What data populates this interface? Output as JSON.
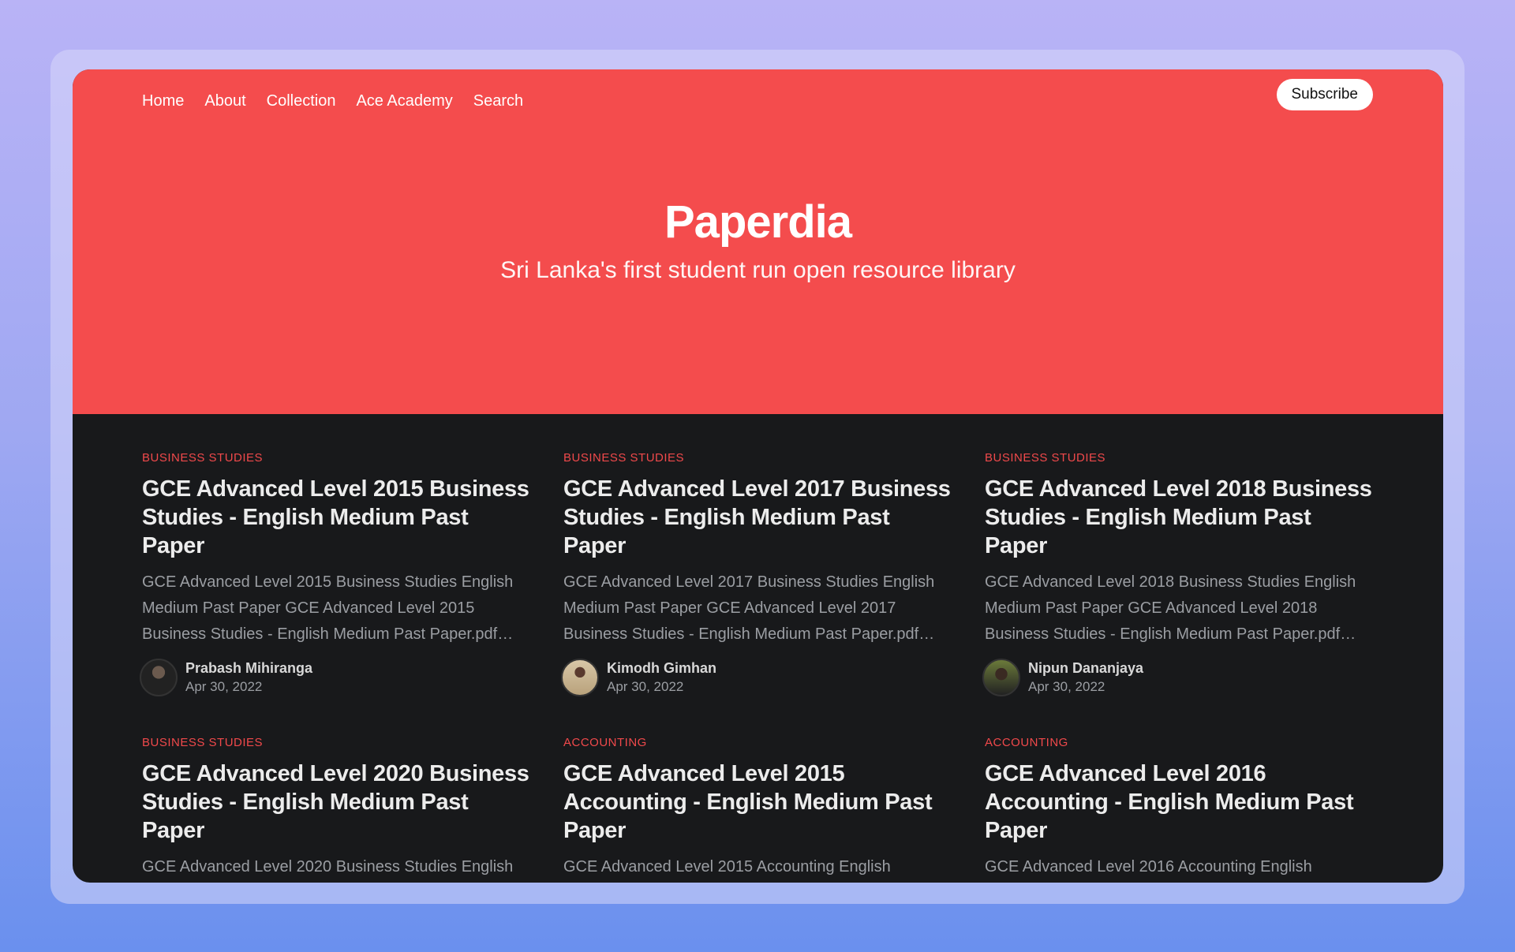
{
  "nav": {
    "items": [
      "Home",
      "About",
      "Collection",
      "Ace Academy",
      "Search"
    ],
    "subscribe": "Subscribe"
  },
  "hero": {
    "title": "Paperdia",
    "subtitle": "Sri Lanka's first student run open resource library"
  },
  "posts": [
    {
      "category": "BUSINESS STUDIES",
      "title": "GCE Advanced Level 2015 Business Studies - English Medium Past Paper",
      "excerpt": "GCE Advanced Level 2015 Business Studies English Medium Past Paper GCE Advanced Level 2015 Business Studies - English Medium Past Paper.pdf…",
      "author": "Prabash Mihiranga",
      "date": "Apr 30, 2022"
    },
    {
      "category": "BUSINESS STUDIES",
      "title": "GCE Advanced Level 2017 Business Studies - English Medium Past Paper",
      "excerpt": "GCE Advanced Level 2017 Business Studies English Medium Past Paper GCE Advanced Level 2017 Business Studies - English Medium Past Paper.pdf…",
      "author": "Kimodh Gimhan",
      "date": "Apr 30, 2022"
    },
    {
      "category": "BUSINESS STUDIES",
      "title": "GCE Advanced Level 2018 Business Studies - English Medium Past Paper",
      "excerpt": "GCE Advanced Level 2018 Business Studies English Medium Past Paper GCE Advanced Level 2018 Business Studies - English Medium Past Paper.pdf…",
      "author": "Nipun Dananjaya",
      "date": "Apr 30, 2022"
    },
    {
      "category": "BUSINESS STUDIES",
      "title": "GCE Advanced Level 2020 Business Studies - English Medium Past Paper",
      "excerpt": "GCE Advanced Level 2020 Business Studies English"
    },
    {
      "category": "ACCOUNTING",
      "title": "GCE Advanced Level 2015 Accounting - English Medium Past Paper",
      "excerpt": "GCE Advanced Level 2015 Accounting English"
    },
    {
      "category": "ACCOUNTING",
      "title": "GCE Advanced Level 2016 Accounting - English Medium Past Paper",
      "excerpt": "GCE Advanced Level 2016 Accounting English"
    }
  ]
}
